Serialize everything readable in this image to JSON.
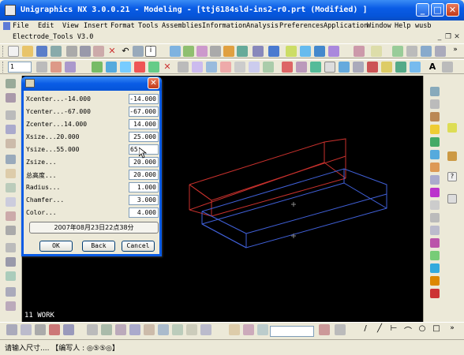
{
  "window": {
    "title": "Unigraphics NX 3.0.0.21 - Modeling - [ttj6184sld-ins2-r0.prt (Modified) ]"
  },
  "menu": {
    "items": [
      "File",
      "Edit",
      "View",
      "Insert",
      "Format",
      "Tools",
      "Assemblies",
      "Information",
      "Analysis",
      "Preferences",
      "Application",
      "Window",
      "Help",
      "wusb"
    ],
    "secondary_label": "Electrode_Tools V3.0"
  },
  "toolbar": {
    "layer_combo_value": "1"
  },
  "viewport": {
    "work_label": "11 WORK"
  },
  "dialog": {
    "fields": [
      {
        "label": "Xcenter...-14.000",
        "value": "-14.000"
      },
      {
        "label": "Ycenter...-67.000",
        "value": "-67.000"
      },
      {
        "label": "Zcenter...14.000",
        "value": "14.000"
      },
      {
        "label": "Xsize...20.000",
        "value": "25.000"
      },
      {
        "label": "Ysize...55.000",
        "value": "65"
      },
      {
        "label": "Zsize...",
        "value": "20.000"
      },
      {
        "label": "总高度...",
        "value": "20.000"
      },
      {
        "label": "Radius...",
        "value": "1.000"
      },
      {
        "label": "Chamfer...",
        "value": "3.000"
      },
      {
        "label": "Color...",
        "value": "4.000"
      }
    ],
    "date_button": "2007年08月23日22点38分",
    "ok": "OK",
    "back": "Back",
    "cancel": "Cancel"
  },
  "status": {
    "text": "请输入尺寸.... 【编写人 : ◎⑤⑤◎】"
  },
  "colors": {
    "box_top": "#c8312d",
    "box_bottom": "#4060d8",
    "xp_blue": "#0a5ce6"
  }
}
